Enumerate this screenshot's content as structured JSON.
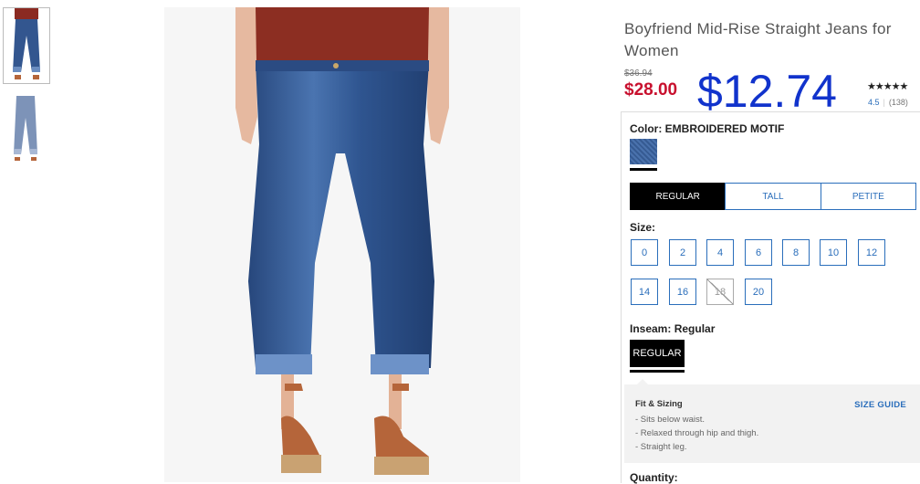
{
  "product": {
    "title": "Boyfriend Mid-Rise Straight Jeans for Women",
    "price_was": "$36.94",
    "price_now": "$28.00",
    "price_deal": "$12.74",
    "rating_stars": "★★★★★",
    "rating_value": "4.5",
    "rating_count": "(138)"
  },
  "color": {
    "label": "Color:",
    "value": "EMBROIDERED MOTIF",
    "swatch_hex": "#3f65a0"
  },
  "fit_tabs": [
    {
      "label": "REGULAR",
      "active": true
    },
    {
      "label": "TALL",
      "active": false
    },
    {
      "label": "PETITE",
      "active": false
    }
  ],
  "size": {
    "label": "Size:",
    "options": [
      {
        "label": "0",
        "available": true
      },
      {
        "label": "2",
        "available": true
      },
      {
        "label": "4",
        "available": true
      },
      {
        "label": "6",
        "available": true
      },
      {
        "label": "8",
        "available": true
      },
      {
        "label": "10",
        "available": true
      },
      {
        "label": "12",
        "available": true
      },
      {
        "label": "14",
        "available": true
      },
      {
        "label": "16",
        "available": true
      },
      {
        "label": "18",
        "available": false
      },
      {
        "label": "20",
        "available": true
      }
    ]
  },
  "inseam": {
    "label": "Inseam:",
    "value": "Regular",
    "button": "REGULAR"
  },
  "fit_sizing": {
    "heading": "Fit & Sizing",
    "guide_link": "SIZE GUIDE",
    "lines": [
      "- Sits below waist.",
      "- Relaxed through hip and thigh.",
      "- Straight leg."
    ]
  },
  "quantity": {
    "label": "Quantity:"
  },
  "colors": {
    "accent": "#2a6ebb",
    "sale_red": "#c8102e",
    "deal_blue": "#1133cc",
    "denim": "#3f65a0"
  }
}
